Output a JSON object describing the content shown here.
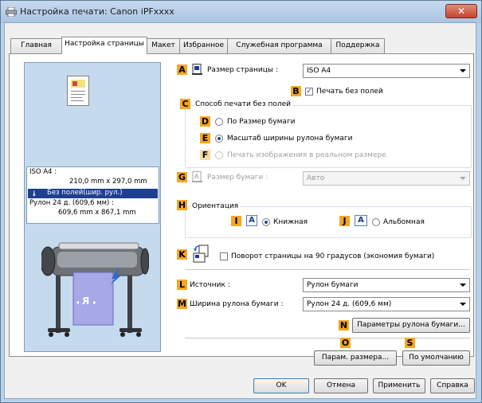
{
  "window": {
    "title": "Настройка печати: Canon iPFxxxx",
    "close_glyph": "✕"
  },
  "tabs": [
    "Главная",
    "Настройка страницы",
    "Макет",
    "Избранное",
    "Служебная программа",
    "Поддержка"
  ],
  "active_tab": "Настройка страницы",
  "markers": {
    "A": "A",
    "B": "B",
    "C": "C",
    "D": "D",
    "E": "E",
    "F": "F",
    "G": "G",
    "H": "H",
    "I": "I",
    "J": "J",
    "K": "K",
    "L": "L",
    "M": "M",
    "N": "N",
    "O": "O",
    "S": "S"
  },
  "preview": {
    "line1": "ISO A4 :",
    "line2": "210,0 mm x 297,0 mm",
    "line3": "Без полей(шир. рул.)",
    "line4": "Рулон 24 д. (609,6 мм) :",
    "line5": "609,6 mm x 867,1 mm",
    "arrow_glyph": "🠗",
    "printed_glyph": "R",
    "nav_left": "◂",
    "nav_right": "▸"
  },
  "page_size": {
    "label": "Размер страницы :",
    "value": "ISO A4"
  },
  "borderless": {
    "label": "Печать без полей",
    "checked": true
  },
  "borderless_method": {
    "label": "Способ печати без полей",
    "options": [
      {
        "label": "По Размер бумаги",
        "selected": false,
        "disabled": false
      },
      {
        "label": "Масштаб ширины рулона бумаги",
        "selected": true,
        "disabled": false
      },
      {
        "label": "Печать изображения в реальном размере",
        "selected": false,
        "disabled": true
      }
    ]
  },
  "paper_size": {
    "label": "Размер бумаги :",
    "value": "Авто",
    "disabled": true
  },
  "orientation": {
    "label": "Ориентация",
    "portrait": "Книжная",
    "landscape": "Альбомная",
    "icon_glyph": "A",
    "selected": "portrait"
  },
  "rotate": {
    "label": "Поворот страницы на 90 градусов (экономия бумаги)",
    "checked": false
  },
  "source": {
    "label": "Источник :",
    "value": "Рулон бумаги"
  },
  "roll_width": {
    "label": "Ширина рулона бумаги :",
    "value": "Рулон 24 д. (609,6 мм)"
  },
  "buttons": {
    "roll_params": "Параметры рулона бумаги...",
    "size_params": "Парам. размера...",
    "defaults": "По умолчанию",
    "ok": "OK",
    "cancel": "Отмена",
    "apply": "Применить",
    "help": "Справка"
  },
  "colors": {
    "marker": "#f5a623",
    "highlight": "#1f3f8f",
    "preview_bg": "#c6daee",
    "paper_blue": "#a7a8e6"
  }
}
